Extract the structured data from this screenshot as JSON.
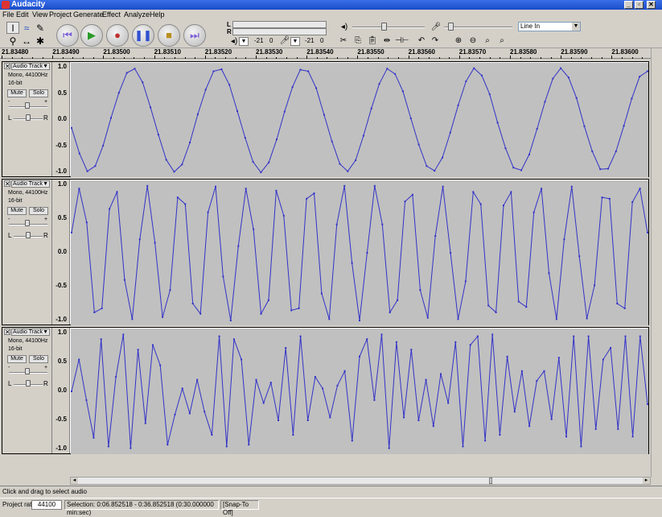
{
  "window": {
    "title": "Audacity",
    "minimize": "_",
    "maximize": "▫",
    "close": "✕"
  },
  "menu": [
    "File",
    "Edit",
    "View",
    "Project",
    "Generate",
    "Effect",
    "Analyze",
    "Help"
  ],
  "meters": {
    "left_label": "L",
    "right_label": "R",
    "play_db": "-21",
    "play_zero": "0",
    "rec_db": "-21",
    "rec_zero": "0"
  },
  "input_source": "Line In",
  "ruler_marks": [
    "21.83480",
    "21.83490",
    "21.83500",
    "21.83510",
    "21.83520",
    "21.83530",
    "21.83540",
    "21.83550",
    "21.83560",
    "21.83570",
    "21.83580",
    "21.83590",
    "21.83600"
  ],
  "tracks": [
    {
      "name": "Audio Track",
      "format": "Mono, 44100Hz",
      "bits": "16-bit",
      "mute": "Mute",
      "solo": "Solo",
      "gain_minus": "-",
      "gain_plus": "+",
      "pan_left": "L",
      "pan_right": "R",
      "scale": [
        "1.0",
        "0.5",
        "0.0",
        "-0.5",
        "-1.0"
      ],
      "samples": [
        -0.15,
        -0.64,
        -0.98,
        -0.88,
        -0.49,
        0.04,
        0.52,
        0.9,
        0.98,
        0.72,
        0.24,
        -0.28,
        -0.76,
        -0.99,
        -0.85,
        -0.43,
        0.11,
        0.58,
        0.93,
        0.97,
        0.67,
        0.17,
        -0.34,
        -0.8,
        -1.0,
        -0.81,
        -0.37,
        0.16,
        0.63,
        0.96,
        0.93,
        0.61,
        0.1,
        -0.41,
        -0.84,
        -0.98,
        -0.77,
        -0.3,
        0.22,
        0.69,
        0.98,
        0.88,
        0.55,
        0.03,
        -0.47,
        -0.88,
        -0.97,
        -0.72,
        -0.24,
        0.28,
        0.74,
        0.99,
        0.85,
        0.49,
        -0.05,
        -0.54,
        -0.91,
        -0.96,
        -0.66,
        -0.17,
        0.35,
        0.79,
        0.99,
        0.81,
        0.42,
        -0.12,
        -0.6,
        -0.94,
        -0.93,
        -0.6,
        -0.11,
        0.41,
        0.83,
        0.93
      ]
    },
    {
      "name": "Audio Track",
      "format": "Mono, 44100Hz",
      "bits": "16-bit",
      "mute": "Mute",
      "solo": "Solo",
      "gain_minus": "-",
      "gain_plus": "+",
      "pan_left": "L",
      "pan_right": "R",
      "scale": [
        "1.0",
        "0.5",
        "0.0",
        "-0.5",
        "-1.0"
      ],
      "samples": [
        0.3,
        0.95,
        0.45,
        -0.88,
        -0.82,
        0.65,
        0.9,
        -0.4,
        -0.98,
        0.2,
        0.99,
        0.15,
        -0.95,
        -0.55,
        0.82,
        0.72,
        -0.75,
        -0.9,
        0.6,
        0.98,
        -0.35,
        -1.0,
        0.1,
        0.95,
        0.35,
        -0.9,
        -0.7,
        0.92,
        0.55,
        -0.85,
        -0.82,
        0.8,
        0.88,
        -0.6,
        -0.98,
        0.42,
        0.99,
        -0.15,
        -1.0,
        0.0,
        0.99,
        0.42,
        -0.88,
        -0.7,
        0.76,
        0.86,
        -0.55,
        -0.96,
        0.25,
        0.98,
        0.0,
        -0.98,
        -0.42,
        0.9,
        0.72,
        -0.78,
        -0.88,
        0.7,
        0.9,
        -0.72,
        -0.8,
        0.6,
        0.95,
        -0.3,
        -0.98,
        0.2,
        0.98,
        -0.05,
        -0.97,
        -0.48,
        0.82,
        0.8,
        -0.75,
        -0.82,
        0.75,
        0.95,
        0.3
      ]
    },
    {
      "name": "Audio Track",
      "format": "Mono, 44100Hz",
      "bits": "16-bit",
      "mute": "Mute",
      "solo": "Solo",
      "gain_minus": "-",
      "gain_plus": "+",
      "pan_left": "L",
      "pan_right": "R",
      "scale": [
        "1.0",
        "0.5",
        "0.0",
        "-0.5",
        "-1.0"
      ],
      "samples": [
        0.0,
        0.55,
        -0.15,
        -0.8,
        0.9,
        -0.95,
        0.25,
        0.98,
        -0.98,
        0.72,
        -0.55,
        0.8,
        0.45,
        -0.92,
        -0.4,
        0.05,
        -0.38,
        0.2,
        -0.35,
        -0.75,
        0.95,
        -0.95,
        0.9,
        0.55,
        -0.92,
        0.2,
        -0.2,
        0.15,
        -0.5,
        0.75,
        -0.75,
        0.95,
        -0.5,
        0.25,
        0.05,
        -0.45,
        0.1,
        0.35,
        -0.85,
        0.6,
        0.9,
        -0.15,
        0.98,
        -0.98,
        0.85,
        -0.45,
        0.72,
        -0.5,
        0.2,
        -0.6,
        0.3,
        -0.2,
        0.85,
        -0.95,
        0.8,
        0.95,
        -0.85,
        0.98,
        -0.75,
        0.6,
        -0.35,
        0.35,
        -0.6,
        0.18,
        0.35,
        -0.48,
        0.58,
        -0.78,
        0.95,
        -0.95,
        0.95,
        -0.65,
        0.55,
        0.75,
        -0.65,
        0.95,
        -0.78,
        0.95,
        -0.22
      ]
    }
  ],
  "status": {
    "hint": "Click and drag to select audio"
  },
  "selection": {
    "rate_label": "Project rate:",
    "rate_value": "44100",
    "selection_text": "Selection: 0:06.852518 - 0:36.852518 (0:30.000000 min:sec)",
    "snap": "[Snap-To Off]"
  }
}
